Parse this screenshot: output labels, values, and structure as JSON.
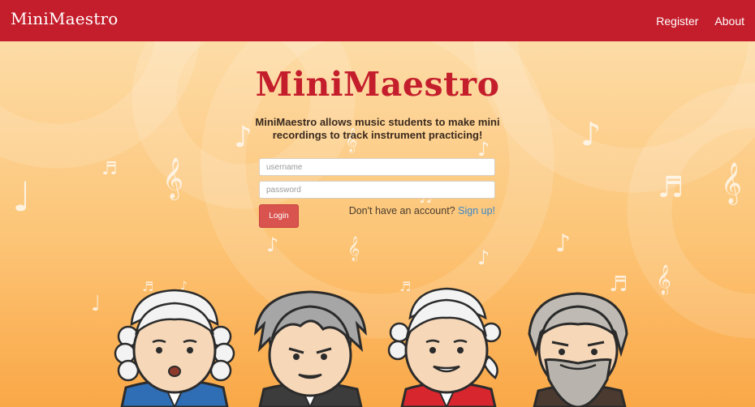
{
  "navbar": {
    "brand": "MiniMaestro",
    "links": [
      {
        "label": "Register"
      },
      {
        "label": "About"
      }
    ]
  },
  "hero": {
    "title": "MiniMaestro",
    "tagline_line1": "MiniMaestro allows music students to make mini",
    "tagline_line2": "recordings to track instrument practicing!"
  },
  "login_form": {
    "username_placeholder": "username",
    "password_placeholder": "password",
    "login_label": "Login",
    "signup_prompt": "Don't have an account?",
    "signup_link": "Sign up!"
  },
  "icons": {
    "note": "eighth-note-icon",
    "beamed": "beamed-notes-icon",
    "clef": "treble-clef-icon",
    "quarter": "quarter-note-icon"
  },
  "colors": {
    "navbar": "#c41e2c",
    "title": "#c41e2c",
    "login_button": "#d9534f",
    "link": "#3b86c6"
  }
}
